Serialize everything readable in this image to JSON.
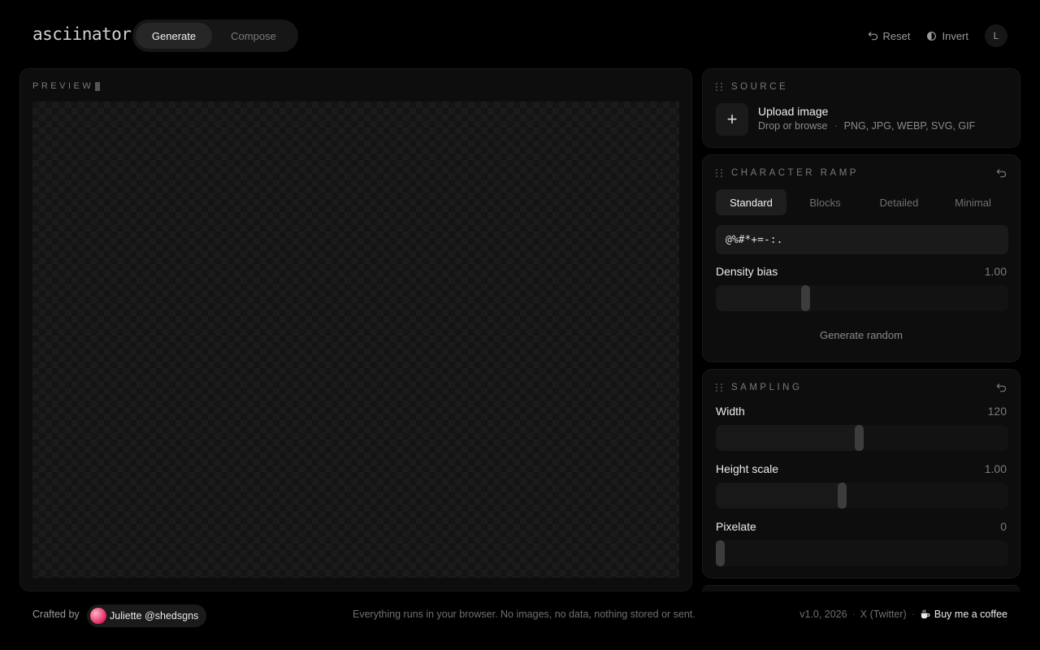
{
  "app": {
    "logo": "asciinator"
  },
  "header": {
    "modes": [
      {
        "label": "Generate",
        "active": true
      },
      {
        "label": "Compose",
        "active": false
      }
    ],
    "reset_label": "Reset",
    "invert_label": "Invert",
    "user_initial": "L"
  },
  "preview": {
    "title": "PREVIEW"
  },
  "source": {
    "title": "SOURCE",
    "upload_title": "Upload image",
    "upload_hint": "Drop or browse",
    "formats": "PNG, JPG, WEBP, SVG, GIF"
  },
  "ramp": {
    "title": "CHARACTER RAMP",
    "tabs": [
      {
        "label": "Standard",
        "active": true
      },
      {
        "label": "Blocks",
        "active": false
      },
      {
        "label": "Detailed",
        "active": false
      },
      {
        "label": "Minimal",
        "active": false
      }
    ],
    "chars": "@%#*+=-:.",
    "density_label": "Density bias",
    "density_value": "1.00",
    "density_fraction": 0.3,
    "generate_random": "Generate random"
  },
  "sampling": {
    "title": "SAMPLING",
    "width_label": "Width",
    "width_value": "120",
    "width_fraction": 0.49,
    "height_label": "Height scale",
    "height_value": "1.00",
    "height_fraction": 0.43,
    "pixelate_label": "Pixelate",
    "pixelate_value": "0",
    "pixelate_fraction": 0.0
  },
  "footer": {
    "crafted_by": "Crafted by",
    "author": "Juliette @shedsgns",
    "note": "Everything runs in your browser. No images, no data, nothing stored or sent.",
    "version": "v1.0, 2026",
    "twitter": "X (Twitter)",
    "coffee": "Buy me a coffee"
  }
}
